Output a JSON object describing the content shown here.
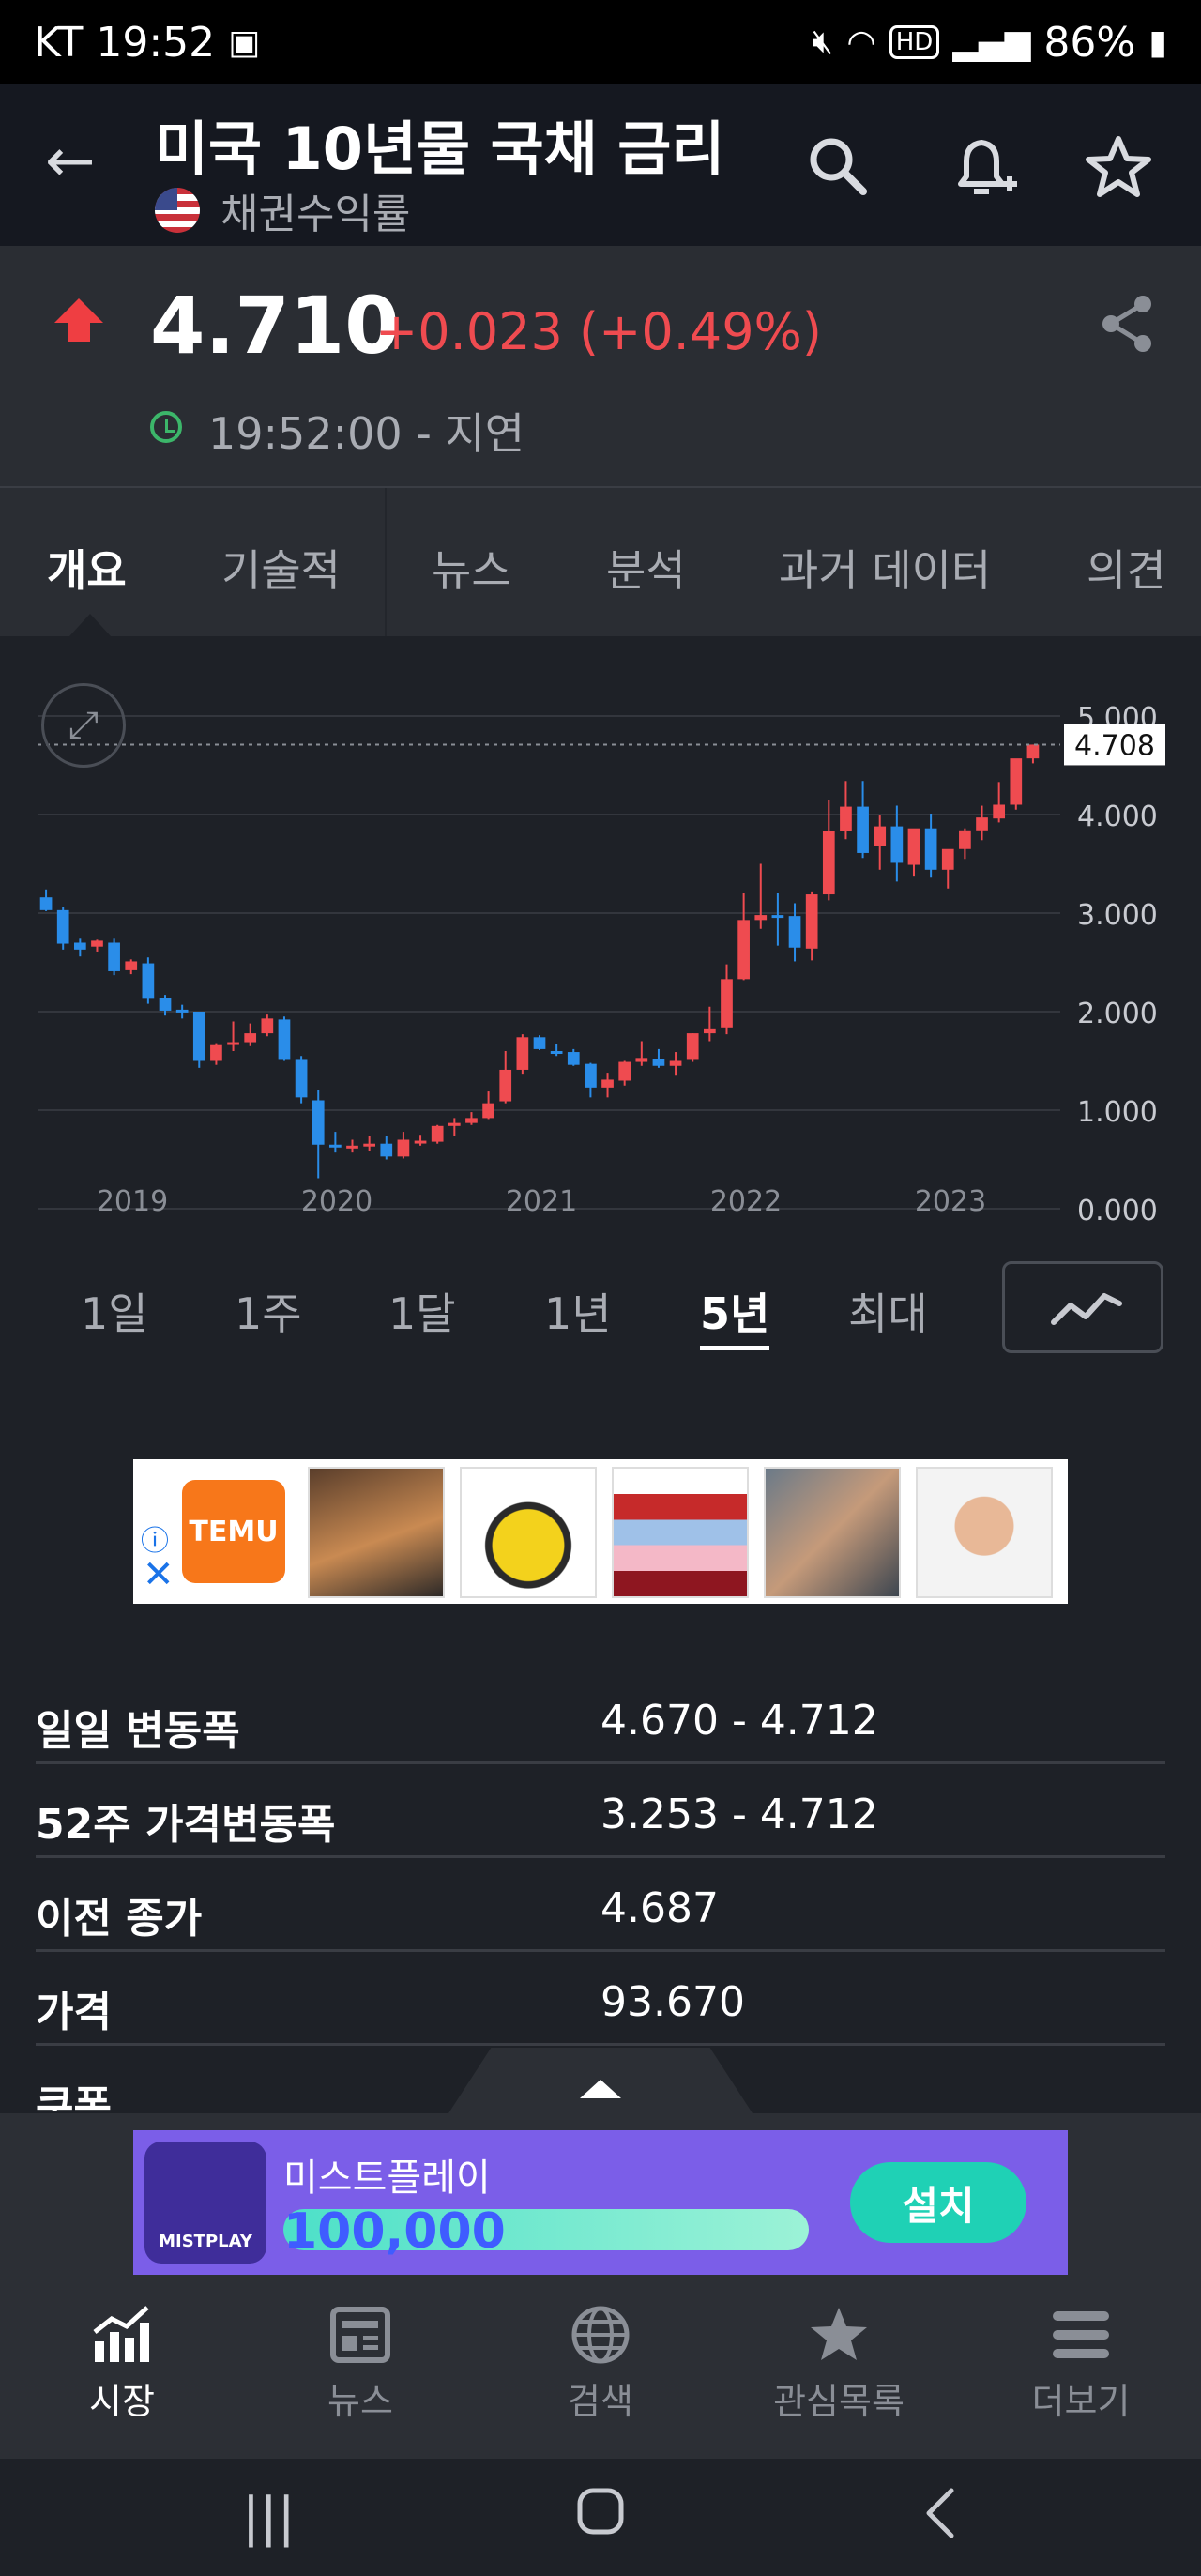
{
  "status_bar": {
    "carrier": "KT",
    "time": "19:52",
    "battery": "86%",
    "icons": [
      "image-icon",
      "mute-icon",
      "wifi-icon",
      "hd-icon",
      "signal-icon",
      "battery-icon"
    ]
  },
  "header": {
    "title": "미국 10년물 국채 금리",
    "subtitle": "채권수익률",
    "icons": [
      "back-arrow-icon",
      "us-flag-icon",
      "search-icon",
      "add-alert-icon",
      "star-icon"
    ]
  },
  "quote": {
    "price": "4.710",
    "change": "+0.023 (+0.49%)",
    "time": "19:52:00 - 지연",
    "up_color": "#ef3e42"
  },
  "tabs": [
    {
      "label": "개요",
      "active": true
    },
    {
      "label": "기술적",
      "active": false
    },
    {
      "label": "뉴스",
      "active": false
    },
    {
      "label": "분석",
      "active": false
    },
    {
      "label": "과거 데이터",
      "active": false
    },
    {
      "label": "의견",
      "active": false
    }
  ],
  "chart_data": {
    "type": "candlestick",
    "x_tick_labels": [
      "2019",
      "2020",
      "2021",
      "2022",
      "2023"
    ],
    "y_tick_labels": [
      "0.000",
      "1.000",
      "2.000",
      "3.000",
      "4.000",
      "5.000"
    ],
    "ylim": [
      0,
      5
    ],
    "current_label": "4.708",
    "up_color": "#ef4b50",
    "down_color": "#2a8de9",
    "candles": [
      {
        "o": 3.16,
        "h": 3.24,
        "l": 3.02,
        "c": 3.03
      },
      {
        "o": 3.03,
        "h": 3.06,
        "l": 2.63,
        "c": 2.69
      },
      {
        "o": 2.7,
        "h": 2.74,
        "l": 2.56,
        "c": 2.63
      },
      {
        "o": 2.66,
        "h": 2.73,
        "l": 2.61,
        "c": 2.72
      },
      {
        "o": 2.7,
        "h": 2.74,
        "l": 2.37,
        "c": 2.41
      },
      {
        "o": 2.42,
        "h": 2.53,
        "l": 2.38,
        "c": 2.51
      },
      {
        "o": 2.49,
        "h": 2.55,
        "l": 2.08,
        "c": 2.13
      },
      {
        "o": 2.14,
        "h": 2.17,
        "l": 1.96,
        "c": 2.01
      },
      {
        "o": 2.02,
        "h": 2.07,
        "l": 1.93,
        "c": 2.0
      },
      {
        "o": 2.0,
        "h": 2.0,
        "l": 1.43,
        "c": 1.5
      },
      {
        "o": 1.5,
        "h": 1.68,
        "l": 1.46,
        "c": 1.66
      },
      {
        "o": 1.68,
        "h": 1.9,
        "l": 1.6,
        "c": 1.69
      },
      {
        "o": 1.69,
        "h": 1.88,
        "l": 1.65,
        "c": 1.78
      },
      {
        "o": 1.78,
        "h": 1.97,
        "l": 1.75,
        "c": 1.93
      },
      {
        "o": 1.92,
        "h": 1.95,
        "l": 1.5,
        "c": 1.51
      },
      {
        "o": 1.51,
        "h": 1.55,
        "l": 1.07,
        "c": 1.13
      },
      {
        "o": 1.1,
        "h": 1.2,
        "l": 0.31,
        "c": 0.65
      },
      {
        "o": 0.65,
        "h": 0.78,
        "l": 0.57,
        "c": 0.63
      },
      {
        "o": 0.63,
        "h": 0.7,
        "l": 0.57,
        "c": 0.64
      },
      {
        "o": 0.65,
        "h": 0.74,
        "l": 0.59,
        "c": 0.66
      },
      {
        "o": 0.66,
        "h": 0.74,
        "l": 0.5,
        "c": 0.53
      },
      {
        "o": 0.53,
        "h": 0.78,
        "l": 0.51,
        "c": 0.7
      },
      {
        "o": 0.68,
        "h": 0.75,
        "l": 0.64,
        "c": 0.69
      },
      {
        "o": 0.68,
        "h": 0.85,
        "l": 0.66,
        "c": 0.84
      },
      {
        "o": 0.84,
        "h": 0.92,
        "l": 0.74,
        "c": 0.87
      },
      {
        "o": 0.87,
        "h": 0.98,
        "l": 0.85,
        "c": 0.92
      },
      {
        "o": 0.92,
        "h": 1.19,
        "l": 0.91,
        "c": 1.07
      },
      {
        "o": 1.09,
        "h": 1.6,
        "l": 1.07,
        "c": 1.41
      },
      {
        "o": 1.41,
        "h": 1.77,
        "l": 1.37,
        "c": 1.74
      },
      {
        "o": 1.74,
        "h": 1.76,
        "l": 1.61,
        "c": 1.62
      },
      {
        "o": 1.6,
        "h": 1.67,
        "l": 1.55,
        "c": 1.59
      },
      {
        "o": 1.59,
        "h": 1.62,
        "l": 1.45,
        "c": 1.46
      },
      {
        "o": 1.47,
        "h": 1.48,
        "l": 1.13,
        "c": 1.23
      },
      {
        "o": 1.23,
        "h": 1.38,
        "l": 1.13,
        "c": 1.31
      },
      {
        "o": 1.3,
        "h": 1.5,
        "l": 1.25,
        "c": 1.49
      },
      {
        "o": 1.49,
        "h": 1.7,
        "l": 1.45,
        "c": 1.53
      },
      {
        "o": 1.52,
        "h": 1.62,
        "l": 1.43,
        "c": 1.45
      },
      {
        "o": 1.45,
        "h": 1.59,
        "l": 1.35,
        "c": 1.5
      },
      {
        "o": 1.51,
        "h": 1.78,
        "l": 1.49,
        "c": 1.78
      },
      {
        "o": 1.78,
        "h": 2.05,
        "l": 1.7,
        "c": 1.83
      },
      {
        "o": 1.84,
        "h": 2.48,
        "l": 1.77,
        "c": 2.33
      },
      {
        "o": 2.33,
        "h": 3.2,
        "l": 2.32,
        "c": 2.93
      },
      {
        "o": 2.93,
        "h": 3.5,
        "l": 2.84,
        "c": 2.98
      },
      {
        "o": 2.98,
        "h": 3.2,
        "l": 2.67,
        "c": 2.96
      },
      {
        "o": 2.97,
        "h": 3.1,
        "l": 2.51,
        "c": 2.65
      },
      {
        "o": 2.64,
        "h": 3.22,
        "l": 2.52,
        "c": 3.19
      },
      {
        "o": 3.19,
        "h": 4.15,
        "l": 3.13,
        "c": 3.83
      },
      {
        "o": 3.83,
        "h": 4.34,
        "l": 3.75,
        "c": 4.08
      },
      {
        "o": 4.08,
        "h": 4.34,
        "l": 3.56,
        "c": 3.61
      },
      {
        "o": 3.68,
        "h": 3.99,
        "l": 3.44,
        "c": 3.88
      },
      {
        "o": 3.88,
        "h": 4.09,
        "l": 3.32,
        "c": 3.51
      },
      {
        "o": 3.49,
        "h": 3.7,
        "l": 3.37,
        "c": 3.86
      },
      {
        "o": 3.86,
        "h": 4.01,
        "l": 3.36,
        "c": 3.44
      },
      {
        "o": 3.44,
        "h": 3.61,
        "l": 3.25,
        "c": 3.65
      },
      {
        "o": 3.65,
        "h": 3.86,
        "l": 3.55,
        "c": 3.84
      },
      {
        "o": 3.84,
        "h": 4.09,
        "l": 3.74,
        "c": 3.97
      },
      {
        "o": 3.96,
        "h": 4.33,
        "l": 3.92,
        "c": 4.1
      },
      {
        "o": 4.1,
        "h": 4.36,
        "l": 4.05,
        "c": 4.57
      },
      {
        "o": 4.57,
        "h": 4.71,
        "l": 4.52,
        "c": 4.71
      }
    ]
  },
  "ranges": [
    {
      "label": "1일",
      "active": false
    },
    {
      "label": "1주",
      "active": false
    },
    {
      "label": "1달",
      "active": false
    },
    {
      "label": "1년",
      "active": false
    },
    {
      "label": "5년",
      "active": true
    },
    {
      "label": "최대",
      "active": false
    }
  ],
  "ad_top": {
    "brand": "TEMU"
  },
  "stats": [
    {
      "label": "일일 변동폭",
      "value": "4.670 - 4.712"
    },
    {
      "label": "52주 가격변동폭",
      "value": "3.253 - 4.712"
    },
    {
      "label": "이전 종가",
      "value": "4.687"
    },
    {
      "label": "가격",
      "value": "93.670"
    },
    {
      "label": "쿠폰",
      "value": ""
    }
  ],
  "ad_bottom": {
    "app_name": "미스트플레이",
    "icon_label": "MISTPLAY",
    "amount": "100,000",
    "button": "설치"
  },
  "bottom_nav": [
    {
      "label": "시장",
      "icon": "market-chart-icon",
      "active": true
    },
    {
      "label": "뉴스",
      "icon": "news-icon",
      "active": false
    },
    {
      "label": "검색",
      "icon": "globe-search-icon",
      "active": false
    },
    {
      "label": "관심목록",
      "icon": "watchlist-star-icon",
      "active": false
    },
    {
      "label": "더보기",
      "icon": "menu-more-icon",
      "active": false
    }
  ]
}
